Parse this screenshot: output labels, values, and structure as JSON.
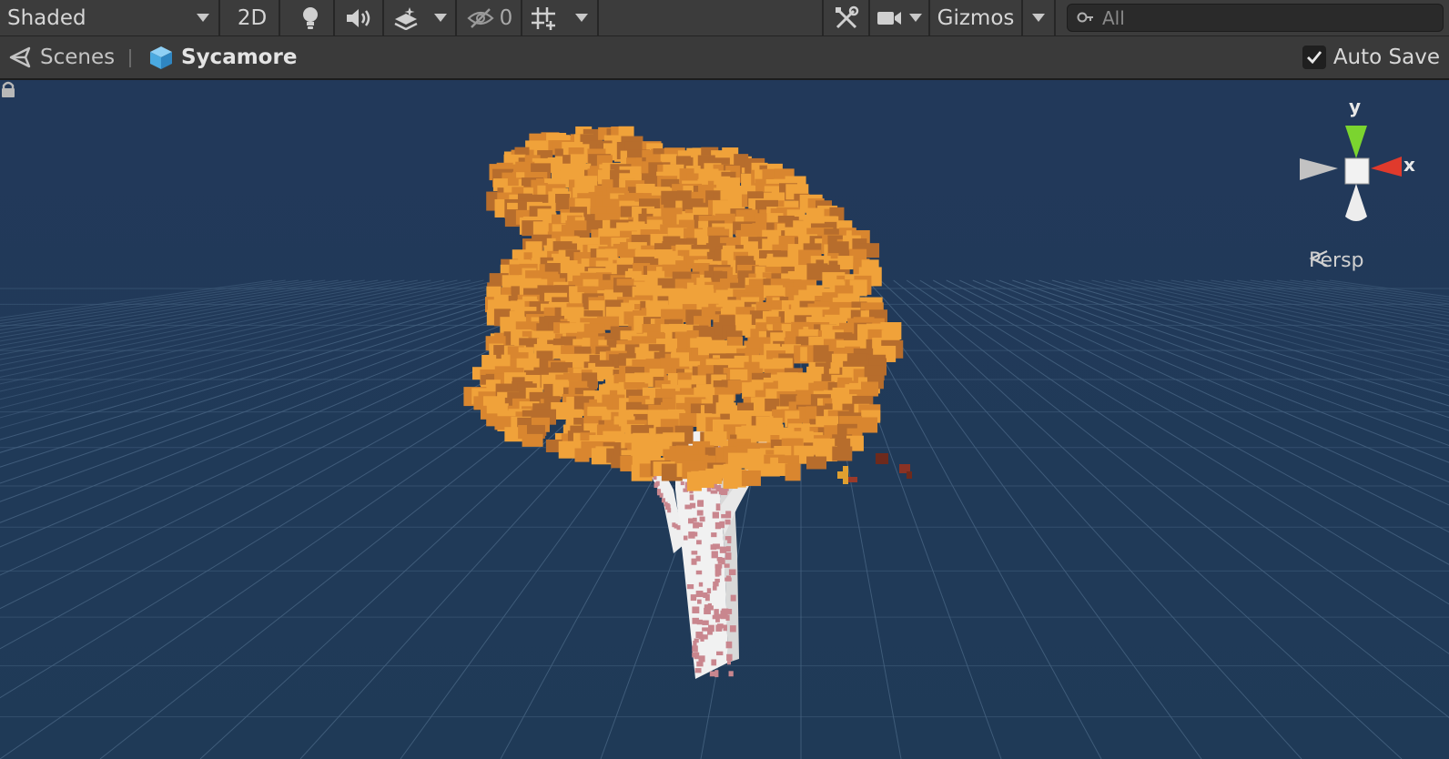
{
  "toolbar": {
    "shading_mode": "Shaded",
    "mode_2d": "2D",
    "hidden_count": "0",
    "gizmos": "Gizmos",
    "search_placeholder": "All",
    "icons": [
      "lighting-icon",
      "audio-icon",
      "effects-icon",
      "visibility-icon",
      "grid-snap-icon",
      "tools-icon",
      "camera-icon",
      "search-icon"
    ]
  },
  "breadcrumb": {
    "scenes": "Scenes",
    "scene_name": "Sycamore",
    "auto_save": "Auto Save",
    "auto_save_checked": true
  },
  "scene": {
    "view_mode": "Persp",
    "axis_labels": {
      "x": "x",
      "y": "y"
    },
    "colors": {
      "background": "#213a55",
      "grid": "#4a6784",
      "leaf_light": "#f0a23a",
      "leaf_dark": "#b76d2c",
      "trunk": "#f2f2f2",
      "bark_spots": "#c9868e",
      "axis_x": "#e03a2c",
      "axis_y": "#7bd42f"
    }
  }
}
